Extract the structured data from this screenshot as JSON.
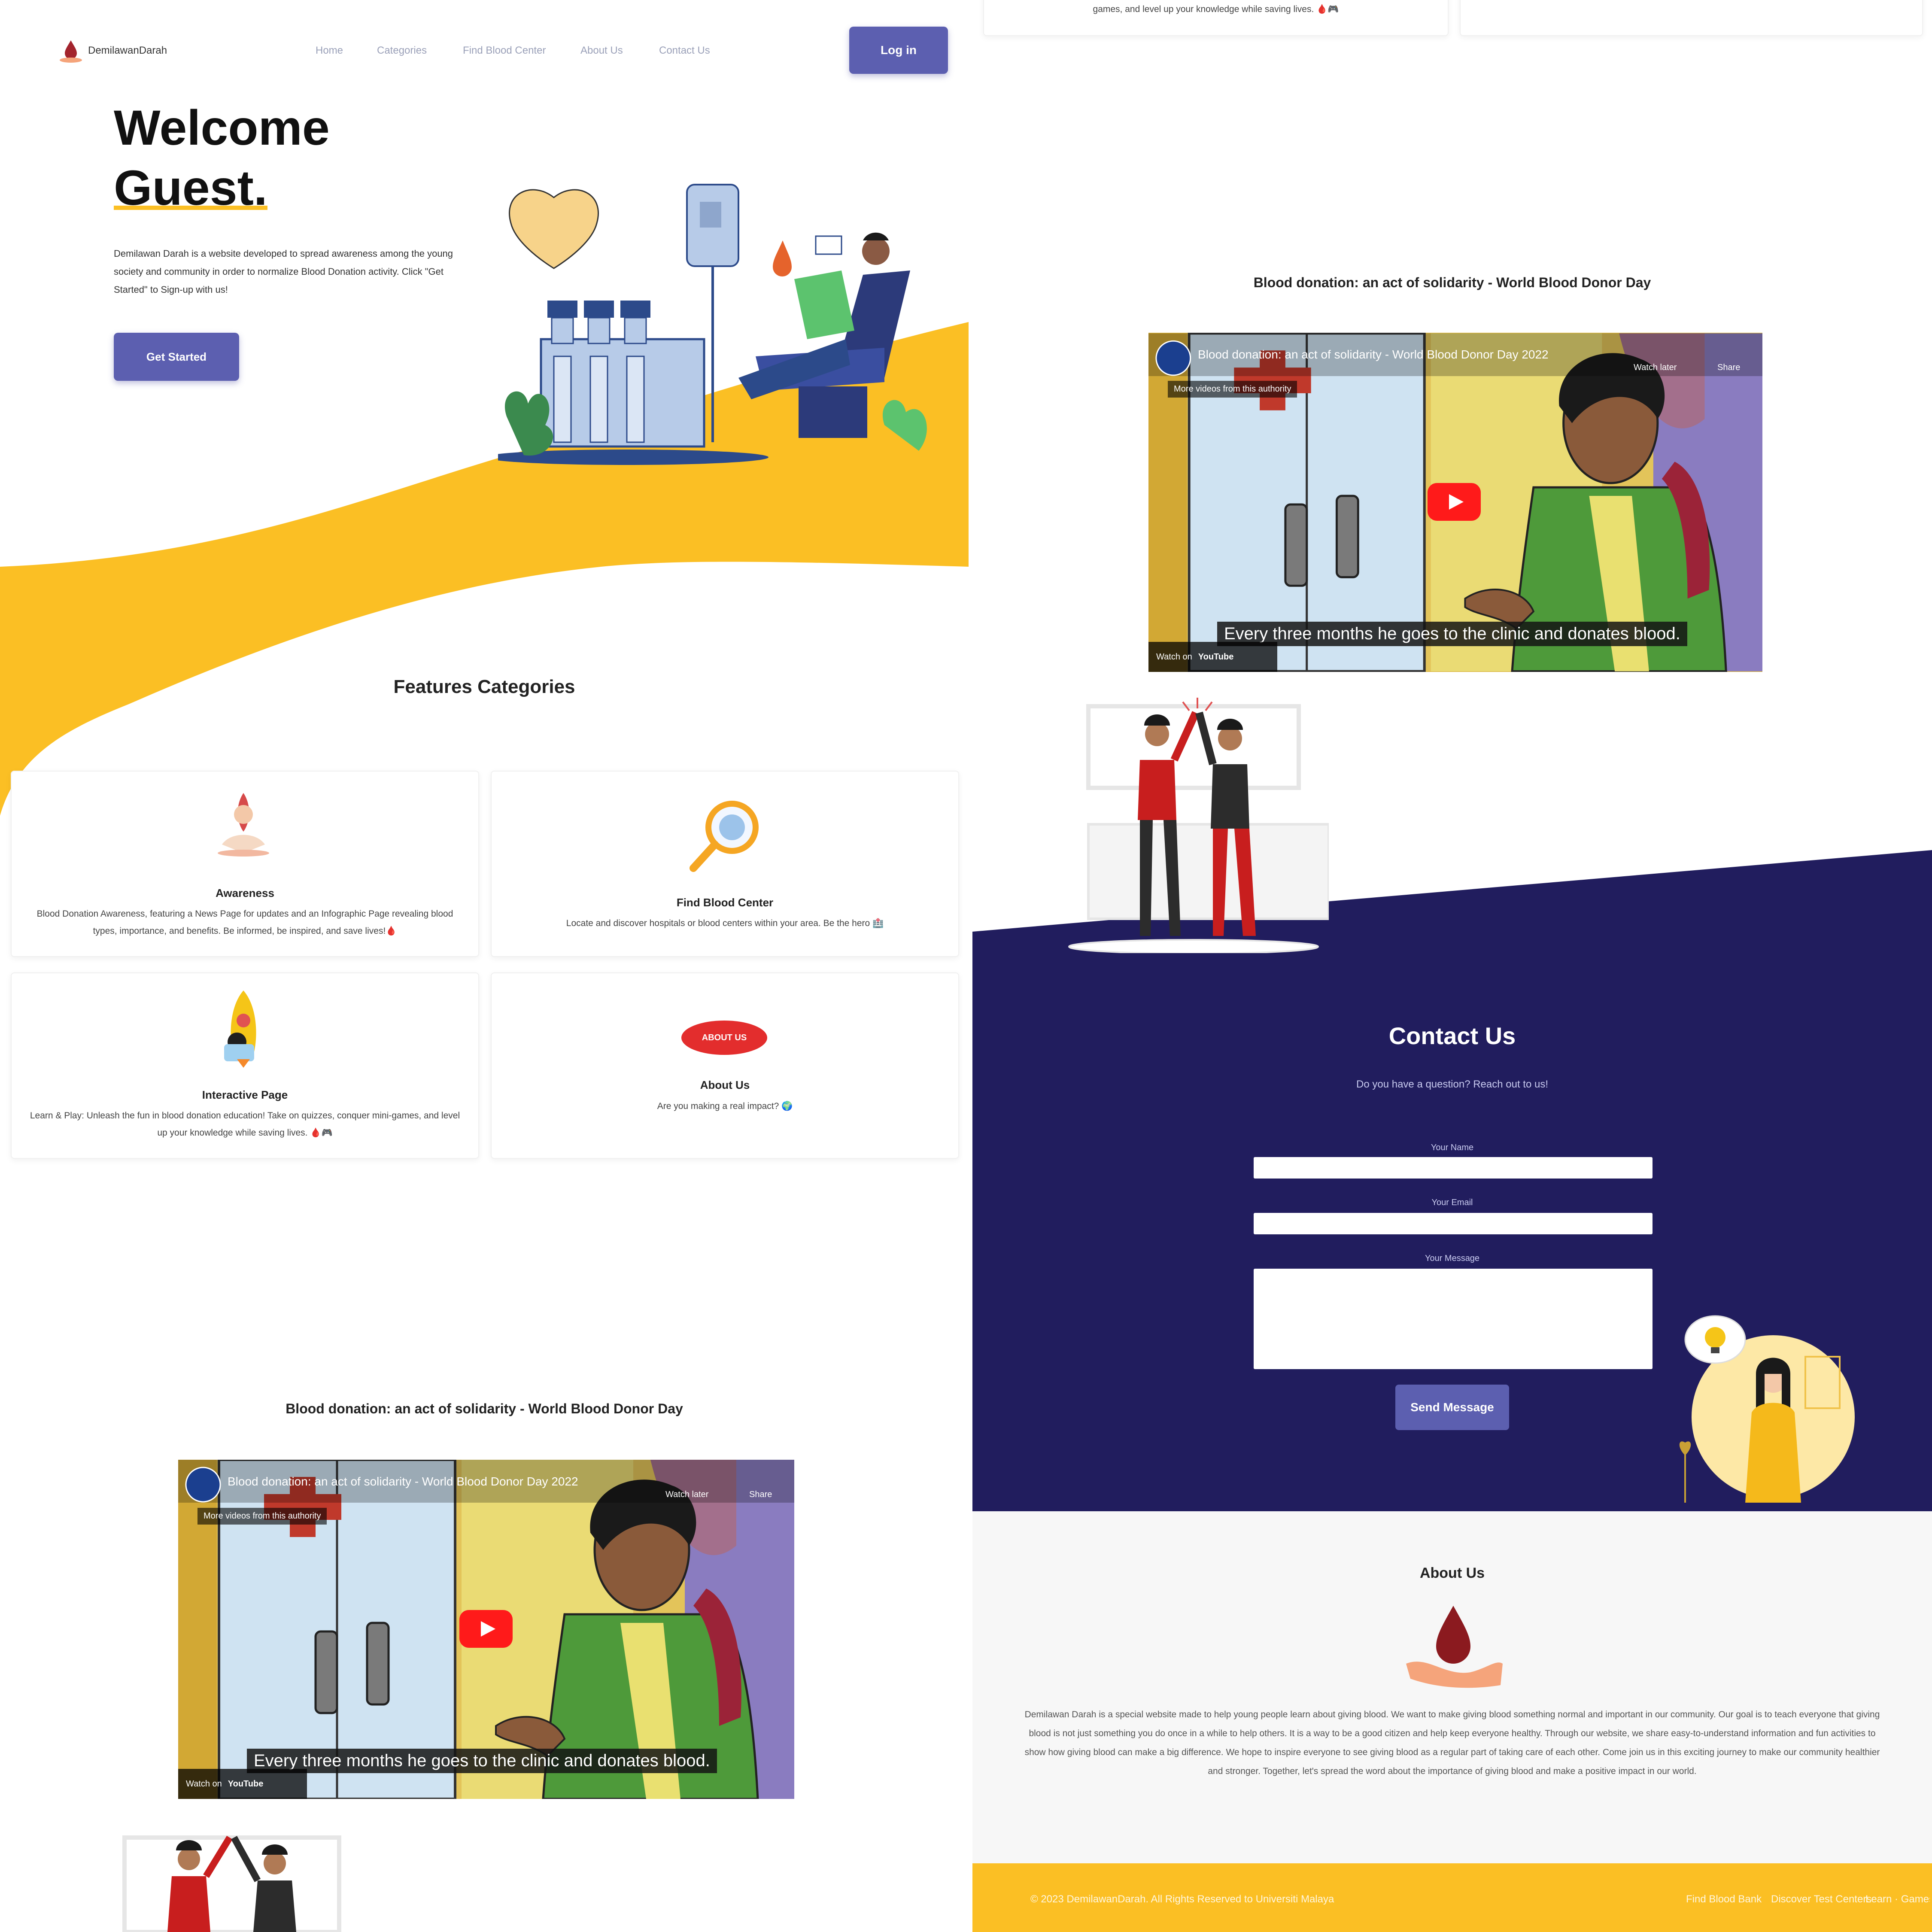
{
  "nav": {
    "brand": "DemilawanDarah",
    "links": [
      "Home",
      "Categories",
      "Find Blood Center",
      "About Us",
      "Contact Us"
    ],
    "login_label": "Log in"
  },
  "hero": {
    "title_line1": "Welcome",
    "title_line2": "Guest.",
    "intro": "Demilawan Darah is a website developed to spread awareness among the young society and community in order to normalize Blood Donation activity. Click \"Get Started\" to Sign-up with us!",
    "cta_label": "Get Started"
  },
  "features": {
    "title": "Features Categories",
    "cards": [
      {
        "title": "Awareness",
        "desc": "Blood Donation Awareness, featuring a News Page for updates and an Infographic Page revealing blood types, importance, and benefits. Be informed, be inspired, and save lives!🩸"
      },
      {
        "title": "Find Blood Center",
        "desc": "Locate and discover hospitals or blood centers within your area. Be the hero 🏥"
      },
      {
        "title": "Interactive Page",
        "desc": "Learn & Play: Unleash the fun in blood donation education! Take on quizzes, conquer mini-games, and level up your knowledge while saving lives. 🩸🎮"
      },
      {
        "title": "About Us",
        "desc": "Are you making a real impact? 🌍"
      }
    ],
    "about_badge": "ABOUT US"
  },
  "video": {
    "section_title": "Blood donation: an act of solidarity - World Blood Donor Day",
    "player_title": "Blood donation: an act of solidarity - World Blood Donor Day 2022",
    "more_videos": "More videos from this authority",
    "watch_later": "Watch later",
    "share": "Share",
    "watch_on": "Watch on",
    "youtube": "YouTube",
    "caption": "Every three months he goes to the clinic and donates blood.",
    "cropped_text": "games, and level up your knowledge while saving lives. 🩸🎮"
  },
  "contact": {
    "title": "Contact Us",
    "subtitle": "Do you have a question? Reach out to us!",
    "name_label": "Your Name",
    "email_label": "Your Email",
    "message_label": "Your Message",
    "send_label": "Send Message"
  },
  "about": {
    "title": "About Us",
    "text": "Demilawan Darah is a special website made to help young people learn about giving blood. We want to make giving blood something normal and important in our community. Our goal is to teach everyone that giving blood is not just something you do once in a while to help others. It is a way to be a good citizen and help keep everyone healthy. Through our website, we share easy-to-understand information and fun activities to show how giving blood can make a big difference. We hope to inspire everyone to see giving blood as a regular part of taking care of each other. Come join us in this exciting journey to make our community healthier and stronger. Together, let's spread the word about the importance of giving blood and make a positive impact in our world."
  },
  "footer": {
    "copyright": "© 2023 DemilawanDarah. All Rights Reserved to Universiti Malaya",
    "links": [
      "Find Blood Bank",
      "Discover Test Centers",
      "Learn · Games"
    ]
  },
  "colors": {
    "accent": "#5c5fb0",
    "yellow": "#fbbf24",
    "navy": "#211d5e"
  }
}
